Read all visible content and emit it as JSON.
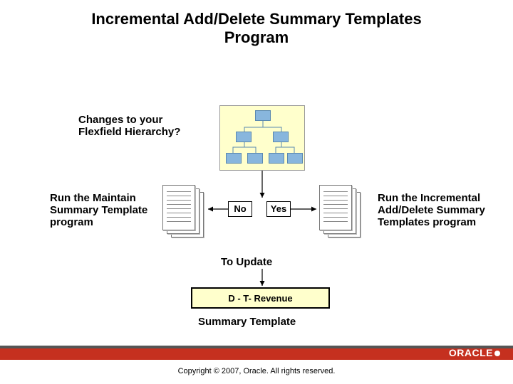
{
  "title_l1": "Incremental Add/Delete Summary Templates",
  "title_l2": "Program",
  "question_l1": "Changes to your",
  "question_l2": "Flexfield Hierarchy?",
  "left_text_l1": "Run the Maintain",
  "left_text_l2": "Summary Template",
  "left_text_l3": "program",
  "right_text_l1": "Run the Incremental",
  "right_text_l2": "Add/Delete Summary",
  "right_text_l3": "Templates program",
  "no_label": "No",
  "yes_label": "Yes",
  "to_update": "To Update",
  "revenue_box": "D - T- Revenue",
  "summary_template": "Summary Template",
  "logo_text": "ORACLE",
  "copyright": "Copyright © 2007, Oracle. All rights reserved."
}
